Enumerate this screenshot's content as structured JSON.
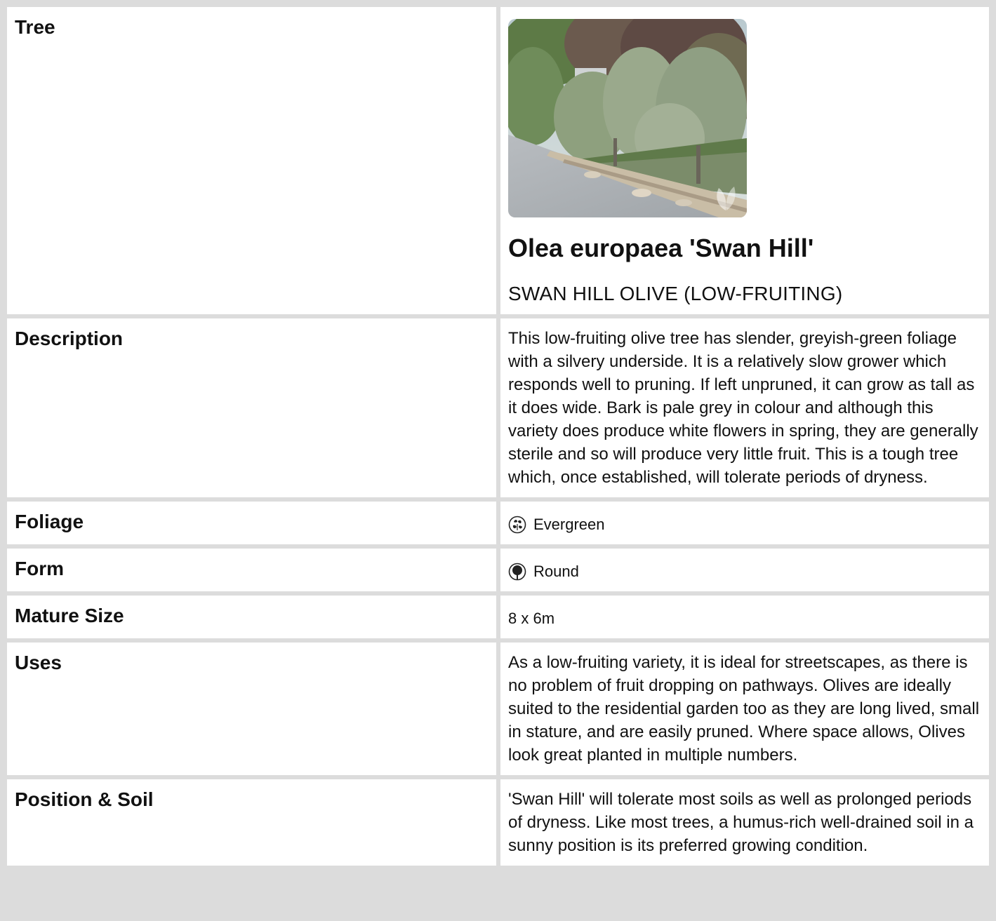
{
  "header": {
    "label": "Tree",
    "plant_name": "Olea europaea 'Swan Hill'",
    "common_name": "SWAN HILL OLIVE (LOW-FRUITING)",
    "photo_icon": "leaf-watermark-icon"
  },
  "rows": {
    "description": {
      "label": "Description",
      "value": "This low-fruiting olive tree has slender, greyish-green foliage with a silvery underside. It is a relatively slow grower which responds well to pruning. If left unpruned, it can grow as tall as it does wide. Bark is pale grey in colour and although this variety does produce white flowers in spring, they are generally sterile and so will produce very little fruit. This is a tough tree which, once established, will tolerate periods of dryness."
    },
    "foliage": {
      "label": "Foliage",
      "value": "Evergreen",
      "icon": "evergreen-leaves-icon"
    },
    "form": {
      "label": "Form",
      "value": "Round",
      "icon": "round-tree-icon"
    },
    "mature_size": {
      "label": "Mature Size",
      "value": "8 x 6m"
    },
    "uses": {
      "label": "Uses",
      "value": "As a low-fruiting variety, it is ideal for streetscapes, as there is no problem of fruit dropping on pathways. Olives are ideally suited to the residential garden too as they are long lived, small in stature, and are easily pruned. Where space allows, Olives look great planted in multiple numbers."
    },
    "position_soil": {
      "label": "Position & Soil",
      "value": "'Swan Hill' will tolerate most soils as well as prolonged periods of dryness. Like most trees, a humus-rich well-drained soil in a sunny position is its preferred growing condition."
    }
  },
  "colors": {
    "border": "#dcdcdc",
    "cell": "#ffffff",
    "text": "#111111"
  }
}
